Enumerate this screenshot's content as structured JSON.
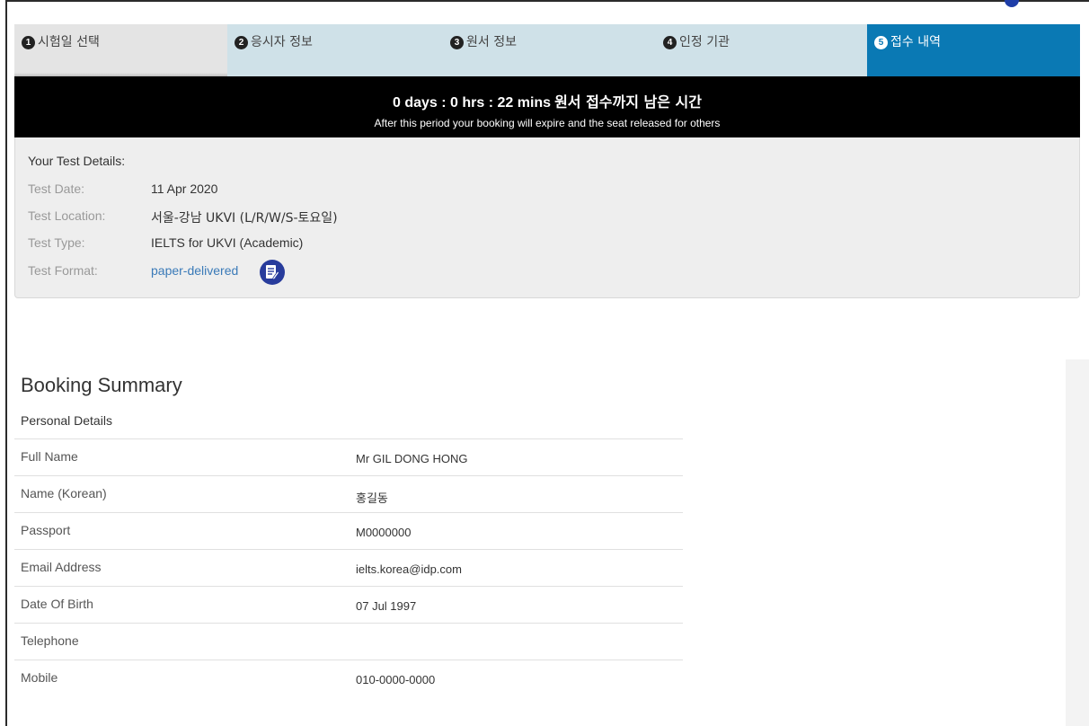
{
  "steps": [
    {
      "num": "1",
      "label": "시험일 선택"
    },
    {
      "num": "2",
      "label": "응시자 정보"
    },
    {
      "num": "3",
      "label": "원서 정보"
    },
    {
      "num": "4",
      "label": "인정 기관"
    },
    {
      "num": "5",
      "label": "접수 내역"
    }
  ],
  "timer": {
    "countdown": "0 days : 0 hrs : 22 mins",
    "countdown_label": "원서 접수까지 남은 시간",
    "notice": "After this period your booking will expire and the seat released for others"
  },
  "test_details": {
    "title": "Your Test Details:",
    "date_label": "Test Date:",
    "date": "11 Apr 2020",
    "location_label": "Test Location:",
    "location": "서울-강남 UKVI (L/R/W/S-토요일)",
    "type_label": "Test Type:",
    "type": "IELTS for UKVI (Academic)",
    "format_label": "Test Format:",
    "format": "paper-delivered",
    "format_icon": "paper-test-icon"
  },
  "booking_summary": {
    "title": "Booking Summary",
    "section_title": "Personal Details",
    "rows": [
      {
        "label": "Full Name",
        "value": "Mr GIL DONG HONG"
      },
      {
        "label": "Name (Korean)",
        "value": "홍길동"
      },
      {
        "label": "Passport",
        "value": "M0000000"
      },
      {
        "label": "Email Address",
        "value": "ielts.korea@idp.com"
      },
      {
        "label": "Date Of Birth",
        "value": "07 Jul 1997"
      },
      {
        "label": "Telephone",
        "value": ""
      },
      {
        "label": "Mobile",
        "value": "010-0000-0000"
      }
    ]
  },
  "colors": {
    "active_step": "#0a79b4",
    "step_bg": "#cfe1e8",
    "timer_bg": "#000000",
    "link": "#3a7ab8",
    "icon_circle": "#283c9c"
  }
}
